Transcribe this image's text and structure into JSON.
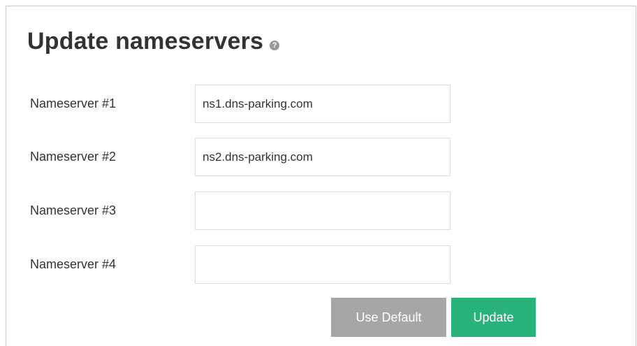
{
  "header": {
    "title": "Update nameservers",
    "help_icon": "question-circle-icon",
    "help_glyph": "?"
  },
  "form": {
    "fields": [
      {
        "label": "Nameserver #1",
        "value": "ns1.dns-parking.com"
      },
      {
        "label": "Nameserver #2",
        "value": "ns2.dns-parking.com"
      },
      {
        "label": "Nameserver #3",
        "value": ""
      },
      {
        "label": "Nameserver #4",
        "value": ""
      }
    ]
  },
  "actions": {
    "use_default_label": "Use Default",
    "update_label": "Update"
  },
  "colors": {
    "update_button": "#2ab27b",
    "use_default_button": "#a6a6a6",
    "title_text": "#333333"
  }
}
